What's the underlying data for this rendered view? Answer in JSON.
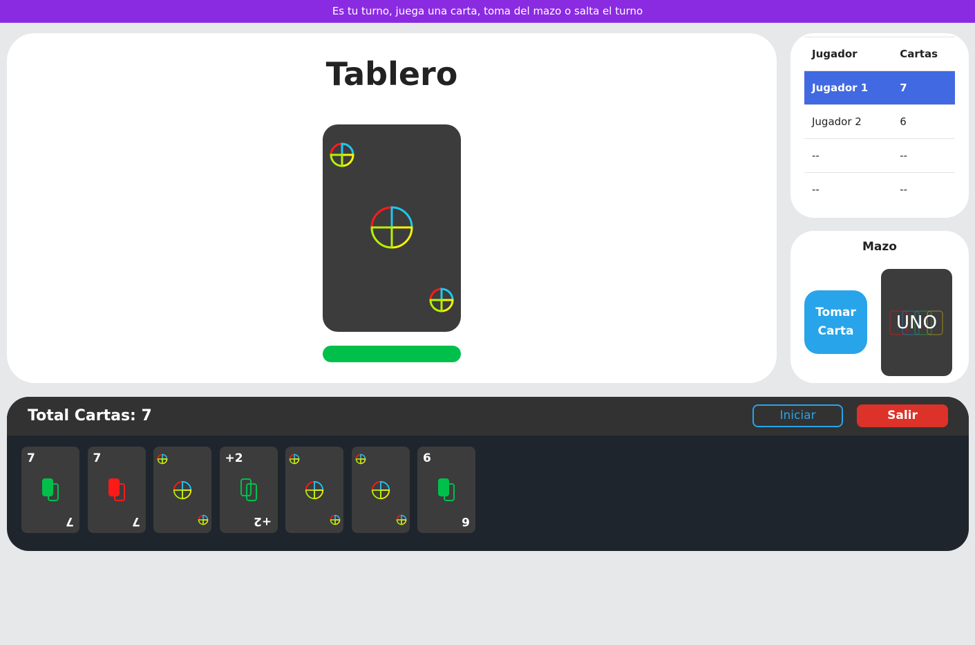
{
  "status": {
    "message": "Es tu turno, juega una carta, toma del mazo o salta el turno"
  },
  "board": {
    "title": "Tablero",
    "current_card": {
      "kind": "wild",
      "icon": "color-wheel-icon"
    },
    "current_color": "#00c04b"
  },
  "players": {
    "headers": {
      "player": "Jugador",
      "cards": "Cartas"
    },
    "rows": [
      {
        "name": "Jugador 1",
        "cards": "7",
        "active": true
      },
      {
        "name": "Jugador 2",
        "cards": "6",
        "active": false
      },
      {
        "name": "--",
        "cards": "--",
        "active": false
      },
      {
        "name": "--",
        "cards": "--",
        "active": false
      }
    ]
  },
  "deck": {
    "title": "Mazo",
    "draw_label_line1": "Tomar",
    "draw_label_line2": "Carta",
    "back_logo": "UNO"
  },
  "hand": {
    "total_label": "Total Cartas: 7",
    "start_label": "Iniciar",
    "exit_label": "Salir",
    "cards": [
      {
        "value": "7",
        "color": "#00c04b",
        "kind": "number"
      },
      {
        "value": "7",
        "color": "#ff1a1a",
        "kind": "number"
      },
      {
        "value": "",
        "color": "wild",
        "kind": "wild"
      },
      {
        "value": "+2",
        "color": "#00c04b",
        "kind": "draw2"
      },
      {
        "value": "",
        "color": "wild",
        "kind": "wild"
      },
      {
        "value": "",
        "color": "wild",
        "kind": "wild"
      },
      {
        "value": "6",
        "color": "#00c04b",
        "kind": "number"
      }
    ]
  },
  "colors": {
    "topbar": "#8a2be2",
    "active_row": "#4169e1",
    "draw_button": "#28a4ea",
    "exit_button": "#dc3229"
  }
}
